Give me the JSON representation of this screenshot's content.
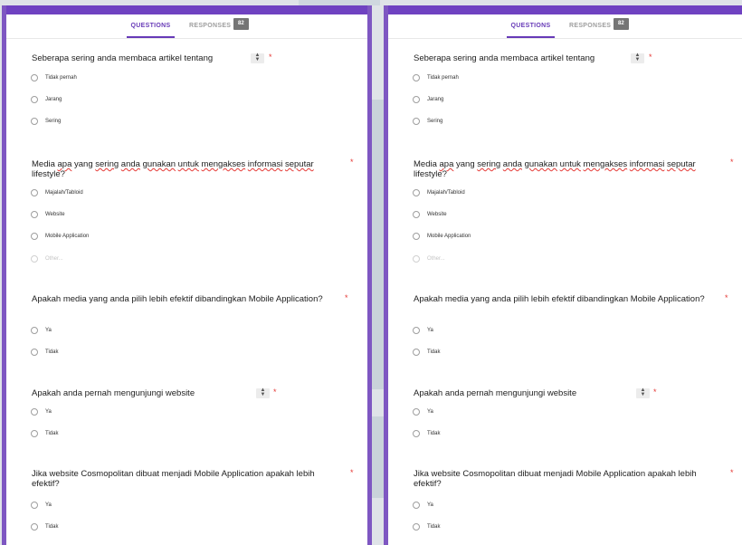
{
  "tabs": {
    "questions": "QUESTIONS",
    "responses": "RESPONSES",
    "responses_count": "82"
  },
  "questions": [
    {
      "title": "Seberapa sering anda membaca artikel tentang",
      "required": "*",
      "options": [
        "Tidak pernah",
        "Jarang",
        "Sering"
      ]
    },
    {
      "title_parts": [
        "Media ",
        "apa",
        " yang ",
        "sering",
        " ",
        "anda",
        " ",
        "gunakan",
        " ",
        "untuk",
        " ",
        "mengakses",
        " ",
        "informasi",
        " ",
        "seputar"
      ],
      "title_line2": "lifestyle?",
      "required": "*",
      "options": [
        "Majalah/Tabloid",
        "Website",
        "Mobile Application"
      ],
      "other": "Other..."
    },
    {
      "title": "Apakah media yang anda pilih lebih efektif dibandingkan Mobile Application?",
      "required": "*",
      "options": [
        "Ya",
        "Tidak"
      ]
    },
    {
      "title": "Apakah anda pernah mengunjungi website",
      "required": "*",
      "options": [
        "Ya",
        "Tidak"
      ]
    },
    {
      "title": "Jika website Cosmopolitan dibuat menjadi Mobile Application apakah lebih",
      "title_line2": "efektif?",
      "required": "*",
      "options": [
        "Ya",
        "Tidak"
      ]
    }
  ],
  "icons": {
    "stepper": "up-down-arrows-icon",
    "radio": "radio-empty-icon"
  },
  "colors": {
    "accent": "#673ab7",
    "frame": "#7e57c2",
    "required": "#e53935",
    "badge": "#757575"
  }
}
